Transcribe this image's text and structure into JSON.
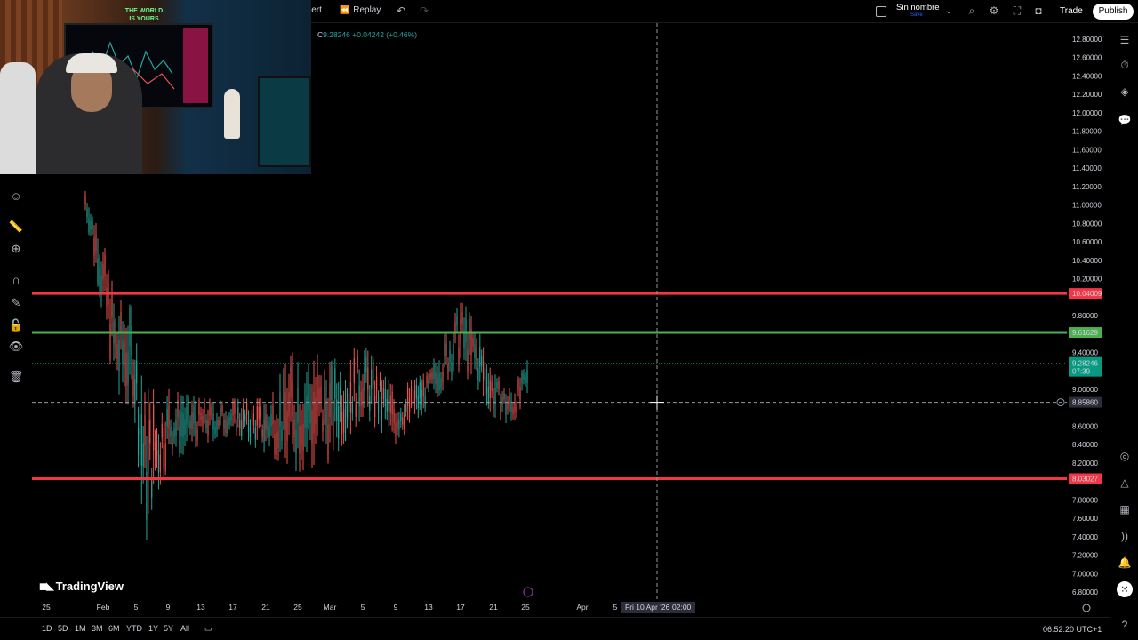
{
  "toolbar": {
    "alert_label": "lert",
    "replay_label": "Replay",
    "layout_name": "Sin nombre",
    "layout_sub": "Save",
    "trade_label": "Trade",
    "publish_label": "Publish"
  },
  "legend": {
    "ohlc_prefix": "C",
    "close": "9.28246",
    "change": "+0.04242 (+0.46%)"
  },
  "webcam": {
    "poster_text": "THE WORLD IS YOURS"
  },
  "price_axis": {
    "ticks": [
      "12.80000",
      "12.60000",
      "12.40000",
      "12.20000",
      "12.00000",
      "11.80000",
      "11.60000",
      "11.40000",
      "11.20000",
      "11.00000",
      "10.80000",
      "10.60000",
      "10.40000",
      "10.20000",
      "9.80000",
      "9.40000",
      "9.00000",
      "8.60000",
      "8.40000",
      "8.20000",
      "7.80000",
      "7.60000",
      "7.40000",
      "7.20000",
      "7.00000",
      "6.80000"
    ],
    "resistance_label": "10.04009",
    "green_label": "9.61629",
    "current_price_label": "9.28246",
    "countdown_label": "07:39",
    "crosshair_label": "8.85860",
    "support_label": "8.03027"
  },
  "time_axis": {
    "ticks": [
      "25",
      "Feb",
      "5",
      "9",
      "13",
      "17",
      "21",
      "25",
      "Mar",
      "5",
      "9",
      "13",
      "17",
      "21",
      "25",
      "Apr",
      "5"
    ],
    "crosshair_label": "Fri 10 Apr '26",
    "crosshair_time": "02:00"
  },
  "branding": {
    "name": "TradingView"
  },
  "bottom": {
    "ranges": [
      "1D",
      "5D",
      "1M",
      "3M",
      "6M",
      "YTD",
      "1Y",
      "5Y",
      "All"
    ],
    "clock": "06:52:20 UTC+1"
  },
  "colors": {
    "resistance": "#f23645",
    "green_level": "#4caf50",
    "up_candle": "#26a69a",
    "down_candle": "#ef5350",
    "current_price_bg": "#089981"
  },
  "chart_data": {
    "type": "candlestick",
    "title": "",
    "ylim": [
      6.8,
      12.8
    ],
    "horizontal_lines": [
      {
        "value": 10.04009,
        "color": "#f23645"
      },
      {
        "value": 9.61629,
        "color": "#4caf50"
      },
      {
        "value": 8.03027,
        "color": "#f23645"
      }
    ],
    "current_price": 9.28246,
    "crosshair": {
      "price": 8.8586,
      "time": "Fri 10 Apr '26 02:00"
    },
    "price_path": [
      {
        "x": "Jan 30",
        "high": 11.2,
        "low": 10.9
      },
      {
        "x": "Feb 1",
        "high": 10.8,
        "low": 10.0
      },
      {
        "x": "Feb 3",
        "high": 10.0,
        "low": 8.9
      },
      {
        "x": "Feb 5",
        "high": 9.9,
        "low": 8.8
      },
      {
        "x": "Feb 6",
        "high": 9.0,
        "low": 7.3
      },
      {
        "x": "Feb 9",
        "high": 9.0,
        "low": 8.2
      },
      {
        "x": "Feb 13",
        "high": 8.9,
        "low": 8.4
      },
      {
        "x": "Feb 17",
        "high": 8.9,
        "low": 8.5
      },
      {
        "x": "Feb 21",
        "high": 8.9,
        "low": 8.3
      },
      {
        "x": "Feb 25",
        "high": 9.5,
        "low": 8.1
      },
      {
        "x": "Mar 1",
        "high": 9.3,
        "low": 8.2
      },
      {
        "x": "Mar 5",
        "high": 9.5,
        "low": 8.7
      },
      {
        "x": "Mar 9",
        "high": 9.0,
        "low": 8.4
      },
      {
        "x": "Mar 13",
        "high": 9.2,
        "low": 8.8
      },
      {
        "x": "Mar 17",
        "high": 10.0,
        "low": 9.2
      },
      {
        "x": "Mar 19",
        "high": 9.7,
        "low": 9.0
      },
      {
        "x": "Mar 21",
        "high": 9.2,
        "low": 8.7
      },
      {
        "x": "Mar 23",
        "high": 9.0,
        "low": 8.6
      },
      {
        "x": "Mar 25",
        "high": 9.35,
        "low": 8.9
      }
    ]
  }
}
